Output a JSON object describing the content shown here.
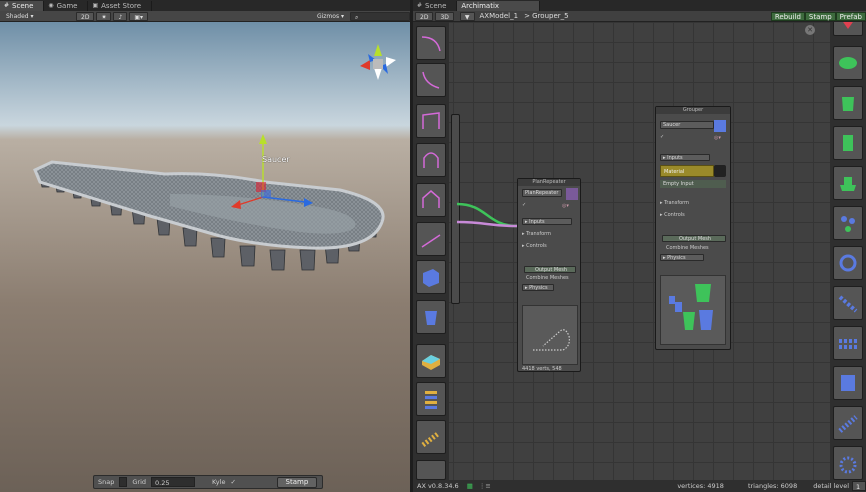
{
  "scene_panel": {
    "tabs": [
      {
        "label": "Scene",
        "active": true
      },
      {
        "label": "Game",
        "active": false
      },
      {
        "label": "Asset Store",
        "active": false
      }
    ],
    "toolbar": {
      "shading_mode": "Shaded",
      "mode_2d": "2D",
      "gizmos_label": "Gizmos"
    },
    "object_label": "Saucer",
    "bottom_bar": {
      "snap_label": "Snap",
      "grid_label": "Grid",
      "grid_value": "0.25",
      "kyle_label": "Kyle",
      "kyle_checked": true,
      "stamp_label": "Stamp"
    }
  },
  "archimatix_panel": {
    "tabs": [
      {
        "label": "Scene",
        "active": false
      },
      {
        "label": "Archimatix",
        "active": true
      }
    ],
    "toolbar": {
      "mode_2d": "2D",
      "mode_3d": "3D",
      "breadcrumb": [
        "AXModel_1",
        "> Grouper_5"
      ],
      "rebuild_label": "Rebuild",
      "stamp_label": "Stamp",
      "prefab_label": "Prefab"
    },
    "plan_repeater_node": {
      "title": "PlanRepeater",
      "name_field": "PlanRepeater",
      "inputs_label": "Inputs",
      "transform_label": "Transform",
      "controls_label": "Controls",
      "output_label": "Output Mesh",
      "combine_label": "Combine Meshes",
      "physics_label": "Physics",
      "stats": "4418 verts, 548"
    },
    "grouper_node": {
      "title": "Grouper",
      "name_field": "Saucer",
      "inputs_label": "Inputs",
      "material_label": "Material",
      "empty_input_label": "Empty Input",
      "transform_label": "Transform",
      "controls_label": "Controls",
      "output_label": "Output Mesh",
      "combine_label": "Combine Meshes",
      "physics_label": "Physics"
    },
    "status": {
      "version": "AX v0.8.34.6",
      "vertices": "vertices: 4918",
      "triangles": "triangles: 6098",
      "detail_label": "detail level",
      "detail_value": "1"
    }
  },
  "colors": {
    "rebuild_green": "#3d6b3d",
    "material_yellow": "#9a8a2a",
    "shape_blue": "#5a7ae0",
    "shape_green": "#3ec35a",
    "link_pink": "#c88ad8"
  }
}
